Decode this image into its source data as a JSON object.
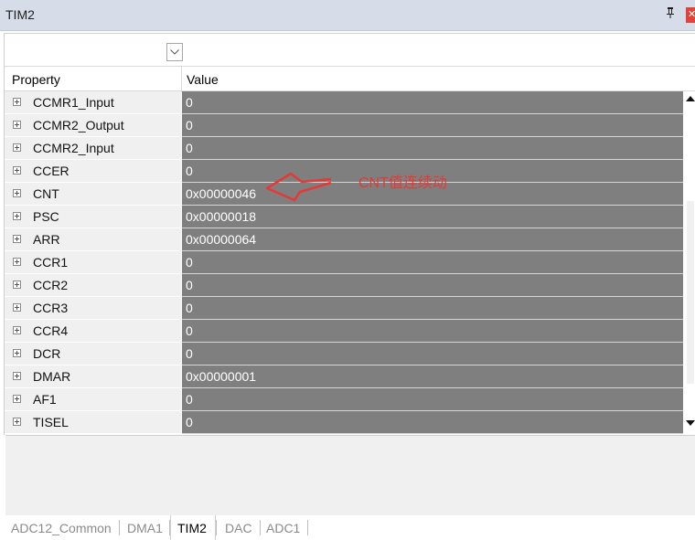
{
  "window": {
    "title": "TIM2",
    "pin_glyph": "ᵖ",
    "close_glyph": "✕"
  },
  "grid": {
    "columns": {
      "property": "Property",
      "value": "Value"
    },
    "rows": [
      {
        "name": "CCMR1_Input",
        "value": "0"
      },
      {
        "name": "CCMR2_Output",
        "value": "0"
      },
      {
        "name": "CCMR2_Input",
        "value": "0"
      },
      {
        "name": "CCER",
        "value": "0"
      },
      {
        "name": "CNT",
        "value": "0x00000046"
      },
      {
        "name": "PSC",
        "value": "0x00000018"
      },
      {
        "name": "ARR",
        "value": "0x00000064"
      },
      {
        "name": "CCR1",
        "value": "0"
      },
      {
        "name": "CCR2",
        "value": "0"
      },
      {
        "name": "CCR3",
        "value": "0"
      },
      {
        "name": "CCR4",
        "value": "0"
      },
      {
        "name": "DCR",
        "value": "0"
      },
      {
        "name": "DMAR",
        "value": "0x00000001"
      },
      {
        "name": "AF1",
        "value": "0"
      },
      {
        "name": "TISEL",
        "value": "0"
      }
    ]
  },
  "annotation": {
    "text": "CNT值连续动",
    "color": "#e53935"
  },
  "tabs": [
    {
      "label": "ADC12_Common",
      "active": false
    },
    {
      "label": "DMA1",
      "active": false
    },
    {
      "label": "TIM2",
      "active": true
    },
    {
      "label": "DAC",
      "active": false
    },
    {
      "label": "ADC1",
      "active": false
    }
  ],
  "colors": {
    "value_cell_bg": "#7f7f7f",
    "title_bar_bg": "#d6dce8",
    "property_cell_bg": "#f0f0f0"
  }
}
